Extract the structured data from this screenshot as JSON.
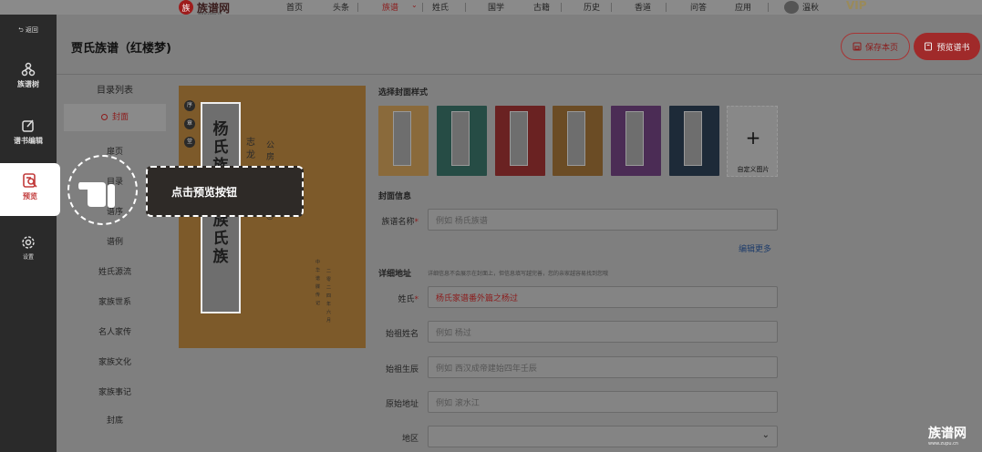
{
  "topnav": {
    "logo_mark": "族",
    "logo_text": "族谱网",
    "logo_sub": "www.zupu.cn",
    "items": [
      "首页",
      "头条",
      "族谱",
      "姓氏",
      "国学",
      "古籍",
      "历史",
      "香道",
      "问答",
      "应用"
    ],
    "active_item": "族谱",
    "user_name": "溫秋",
    "vip_label": "VIP"
  },
  "sidebar": {
    "back_label": "返回",
    "items": [
      {
        "label": "族谱树",
        "icon": "family-tree-icon"
      },
      {
        "label": "谱书编辑",
        "icon": "edit-icon"
      },
      {
        "label": "预览",
        "icon": "preview-icon"
      },
      {
        "label": "设置",
        "icon": "gear-icon"
      }
    ],
    "active_item": "预览"
  },
  "header": {
    "title": "贾氏族谱（红楼梦)",
    "save_label": "保存本页",
    "preview_label": "预览谱书"
  },
  "toc": {
    "title": "目录列表",
    "items": [
      "封面",
      "扉页",
      "目录",
      "谱序",
      "谱例",
      "姓氏源流",
      "家族世系",
      "名人家传",
      "家族文化",
      "家族事记",
      "封底"
    ],
    "active_item": "封面"
  },
  "cover_preview": {
    "main_title_1": "杨氏族",
    "main_title_2": "杨氏族氏族",
    "seals": [
      "序",
      "章",
      "堂"
    ],
    "side_1": "志龙",
    "side_2": "公房◎第二卷◎",
    "small_1": "中华谱牒传记",
    "small_2": "二零二四年六月"
  },
  "form": {
    "cover_style_label": "选择封面样式",
    "cover_styles": [
      "#8a6a3b",
      "#264c45",
      "#6a2222",
      "#6b4c25",
      "#4b2c55",
      "#1d2a38"
    ],
    "custom_cover_label": "自定义图片",
    "cover_info_label": "封面信息",
    "genealogy_name_label": "族谱名称",
    "genealogy_name_placeholder": "例如 杨氏族谱",
    "edit_more_label": "编辑更多",
    "address_label": "详细地址",
    "address_hint": "详细信息不会展示在封面上，但信息填写越完善，您的亲家越容易找到您哦",
    "surname_label": "姓氏",
    "surname_value": "杨氏家谱番外篇之杨过",
    "ancestor_name_label": "始祖姓名",
    "ancestor_name_placeholder": "例如 杨过",
    "ancestor_birth_label": "始祖生辰",
    "ancestor_birth_placeholder": "例如 西汉成帝建始四年壬辰",
    "origin_label": "原始地址",
    "origin_placeholder": "例如 滚水江",
    "region_label": "地区",
    "region_value": ""
  },
  "tip": {
    "text": "点击预览按钮"
  },
  "brand": {
    "name": "族谱网",
    "url": "www.zupu.cn"
  }
}
